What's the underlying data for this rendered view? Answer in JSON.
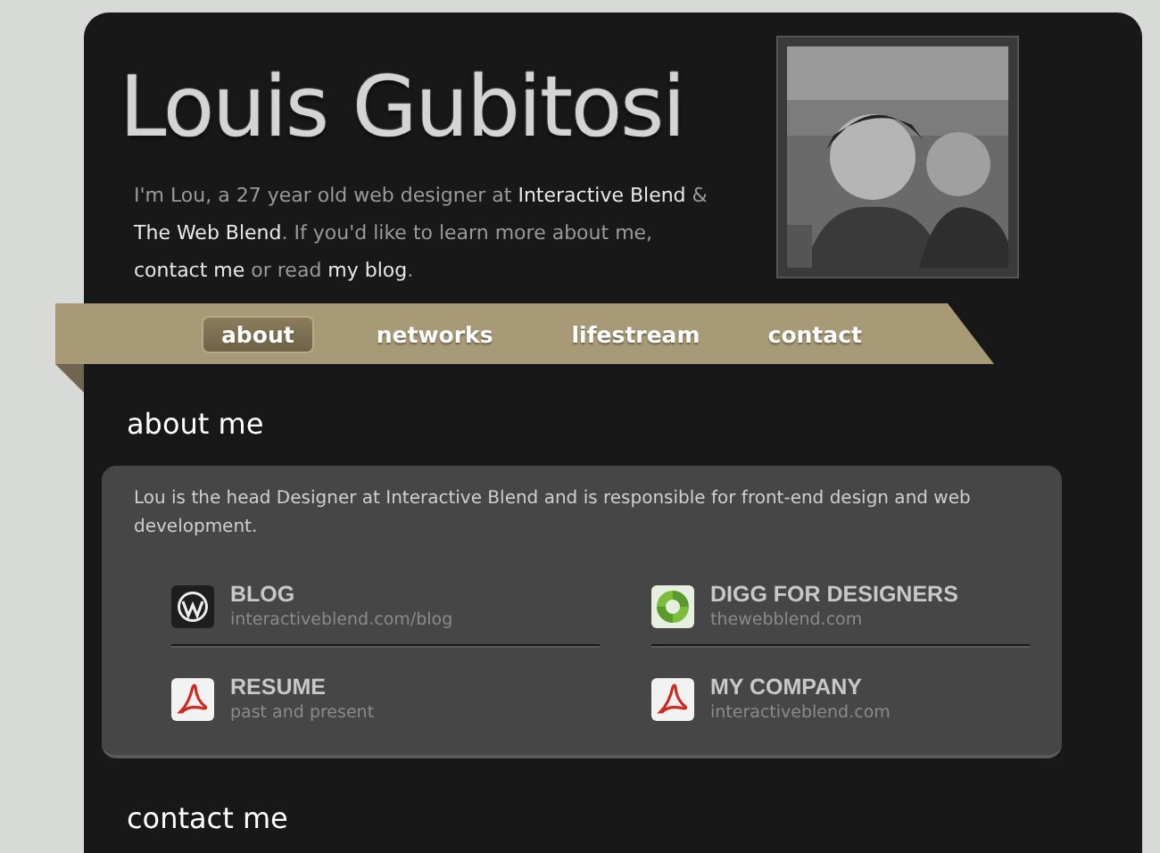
{
  "header": {
    "title": "Louis Gubitosi",
    "bio": [
      {
        "text": "I'm Lou, a 27 year old web designer at ",
        "link": false
      },
      {
        "text": "Interactive Blend",
        "link": true
      },
      {
        "text": " & ",
        "link": false
      },
      {
        "text": "The Web Blend",
        "link": true
      },
      {
        "text": ". If you'd like to learn more about me, ",
        "link": false
      },
      {
        "text": "contact me",
        "link": true
      },
      {
        "text": " or read ",
        "link": false
      },
      {
        "text": "my blog",
        "link": true
      },
      {
        "text": ".",
        "link": false
      }
    ]
  },
  "nav": [
    {
      "label": "about",
      "selected": true
    },
    {
      "label": "networks",
      "selected": false
    },
    {
      "label": "lifestream",
      "selected": false
    },
    {
      "label": "contact",
      "selected": false
    }
  ],
  "about": {
    "heading": "about me",
    "text": "Lou is the head Designer at Interactive Blend and is responsible for front-end design and web development.",
    "links": [
      {
        "kind": "wordpress",
        "title": "BLOG",
        "subtitle": "interactiveblend.com/blog"
      },
      {
        "kind": "swirl",
        "title": "DIGG FOR DESIGNERS",
        "subtitle": "thewebblend.com"
      },
      {
        "kind": "pdf",
        "title": "RESUME",
        "subtitle": "past and present"
      },
      {
        "kind": "pdf",
        "title": "MY COMPANY",
        "subtitle": "interactiveblend.com"
      }
    ]
  },
  "contact": {
    "heading": "contact me"
  }
}
